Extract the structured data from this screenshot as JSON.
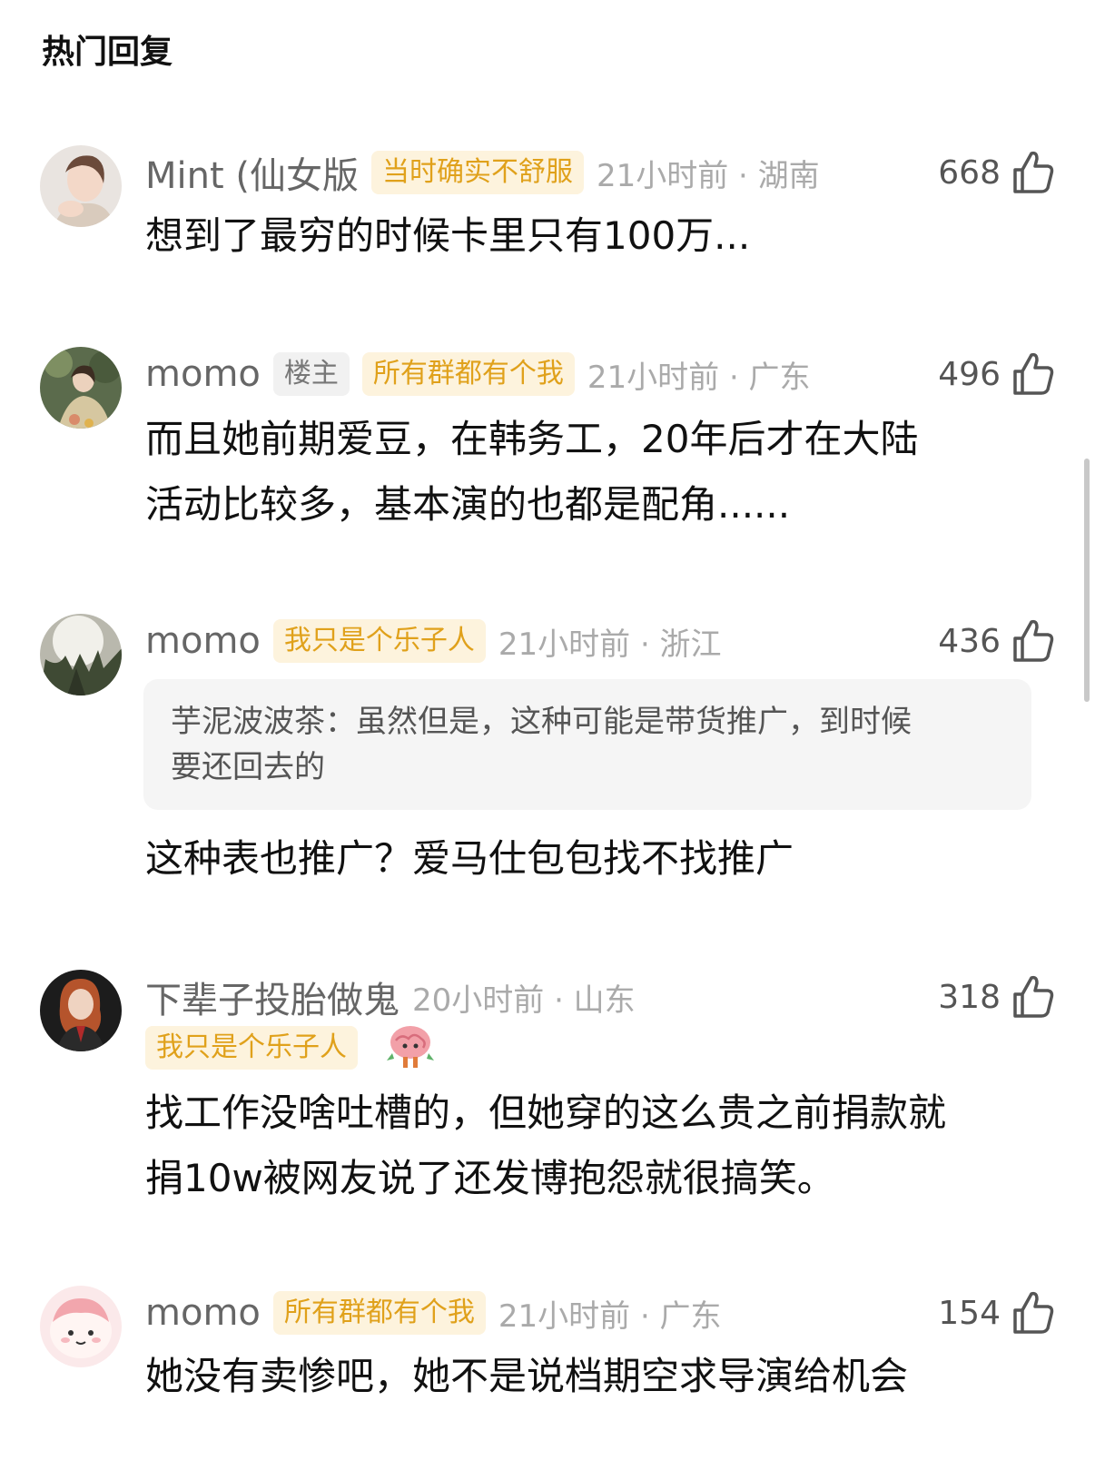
{
  "section_title": "热门回复",
  "comments": [
    {
      "username": "Mint (仙女版",
      "tags": [
        {
          "text": "当时确实不舒服",
          "style": "gold"
        }
      ],
      "time_location": "21小时前 · 湖南",
      "likes": "668",
      "body": "想到了最穷的时候卡里只有100万..."
    },
    {
      "username": "momo",
      "tags": [
        {
          "text": "楼主",
          "style": "gray"
        },
        {
          "text": "所有群都有个我",
          "style": "gold"
        }
      ],
      "time_location": "21小时前 · 广东",
      "likes": "496",
      "body_lines": [
        "而且她前期爱豆，在韩务工，20年后才在大陆",
        "活动比较多，基本演的也都是配角......"
      ]
    },
    {
      "username": "momo",
      "tags": [
        {
          "text": "我只是个乐子人",
          "style": "gold"
        }
      ],
      "time_location": "21小时前 · 浙江",
      "likes": "436",
      "quote_lines": [
        "芋泥波波茶：虽然但是，这种可能是带货推广，到时候",
        "要还回去的"
      ],
      "body": "这种表也推广？爱马仕包包找不找推广"
    },
    {
      "username": "下辈子投胎做鬼",
      "tags": [
        {
          "text": "我只是个乐子人",
          "style": "gold"
        }
      ],
      "time_location": "20小时前 · 山东",
      "likes": "318",
      "body_lines": [
        "找工作没啥吐槽的，但她穿的这么贵之前捐款就",
        "捐10w被网友说了还发博抱怨就很搞笑。"
      ]
    },
    {
      "username": "momo",
      "tags": [
        {
          "text": "所有群都有个我",
          "style": "gold"
        }
      ],
      "time_location": "21小时前 · 广东",
      "likes": "154",
      "body": "她没有卖惨吧，她不是说档期空求导演给机会"
    }
  ],
  "icons": {
    "like": "thumbs-up-icon",
    "sticker": "brain-sticker-icon"
  },
  "colors": {
    "tag_gold_bg": "#fdf3dd",
    "tag_gold_text": "#e0a11b",
    "tag_gray_bg": "#f1f1f1",
    "username": "#666666",
    "meta": "#aaaaaa"
  }
}
